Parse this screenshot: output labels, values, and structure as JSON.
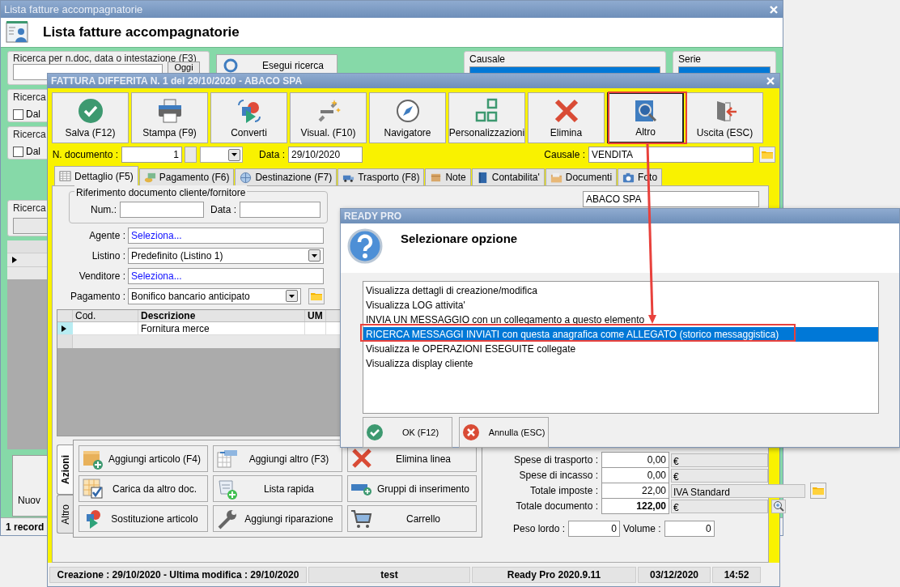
{
  "background_window": {
    "title": "Lista fatture accompagnatorie",
    "heading": "Lista fatture accompagnatorie",
    "search_group": {
      "label": "Ricerca per n.doc, data o intestazione (F3)",
      "button": "Oggi"
    },
    "search_button": "Esegui ricerca",
    "causale_label": "Causale",
    "serie_label": "Serie",
    "filters": [
      {
        "label": "Ricerca",
        "option": "Dal",
        "checked": false
      },
      {
        "label": "Ricerca",
        "option": "Dal",
        "checked": false
      }
    ],
    "search_label": "Ricerca",
    "new_button": "Nuov",
    "status": "1 record"
  },
  "invoice_window": {
    "title": "FATTURA DIFFERITA N. 1 del 29/10/2020 - ABACO SPA",
    "toolbar": [
      {
        "label": "Salva (F12)",
        "kind": "save",
        "selected": false
      },
      {
        "label": "Stampa (F9)",
        "kind": "print",
        "selected": false
      },
      {
        "label": "Converti",
        "kind": "convert",
        "selected": false
      },
      {
        "label": "Visual. (F10)",
        "kind": "visual",
        "selected": false
      },
      {
        "label": "Navigatore",
        "kind": "compass",
        "selected": false
      },
      {
        "label": "Personalizzazioni",
        "kind": "custom",
        "selected": false
      },
      {
        "label": "Elimina",
        "kind": "delete",
        "selected": false
      },
      {
        "label": "Altro",
        "kind": "other",
        "selected": true
      },
      {
        "label": "Uscita (ESC)",
        "kind": "exit",
        "selected": false
      }
    ],
    "doc_number": {
      "label": "N. documento :",
      "value": "1"
    },
    "date": {
      "label": "Data :",
      "value": "29/10/2020"
    },
    "causale": {
      "label": "Causale :",
      "value": "VENDITA"
    },
    "tabs": [
      {
        "label": "Dettaglio (F5)",
        "kind": "table",
        "selected": true
      },
      {
        "label": "Pagamento (F6)",
        "kind": "money",
        "selected": false
      },
      {
        "label": "Destinazione (F7)",
        "kind": "globe",
        "selected": false
      },
      {
        "label": "Trasporto (F8)",
        "kind": "truck",
        "selected": false
      },
      {
        "label": "Note",
        "kind": "note",
        "selected": false
      },
      {
        "label": "Contabilita'",
        "kind": "book",
        "selected": false
      },
      {
        "label": "Documenti",
        "kind": "folder",
        "selected": false
      },
      {
        "label": "Foto",
        "kind": "camera",
        "selected": false
      }
    ],
    "reference": {
      "label": "Riferimento documento cliente/fornitore",
      "num_label": "Num.:",
      "date_label": "Data :"
    },
    "customer": "ABACO SPA",
    "fields": [
      {
        "label": "Agente :",
        "value": "Seleziona...",
        "kind": "link"
      },
      {
        "label": "Listino :",
        "value": "Predefinito (Listino 1)",
        "kind": "select"
      },
      {
        "label": "Venditore :",
        "value": "Seleziona...",
        "kind": "link"
      },
      {
        "label": "Pagamento :",
        "value": "Bonifico bancario anticipato",
        "kind": "select_folder"
      }
    ],
    "grid": {
      "columns": [
        {
          "label": "Cod.",
          "bold": false
        },
        {
          "label": "Descrizione",
          "bold": true
        },
        {
          "label": "UM",
          "bold": true
        }
      ],
      "rows": [
        {
          "description": "Fornitura merce",
          "selected": true
        }
      ]
    },
    "side_tabs": [
      {
        "label": "Azioni",
        "selected": true
      },
      {
        "label": "Altro",
        "selected": false
      }
    ],
    "actions": [
      {
        "label": "Aggiungi articolo (F4)",
        "kind": "box_add"
      },
      {
        "label": "Aggiungi altro (F3)",
        "kind": "table_add"
      },
      {
        "label": "Elimina linea",
        "kind": "delete"
      },
      {
        "label": "Carica da altro doc.",
        "kind": "table_check"
      },
      {
        "label": "Lista rapida",
        "kind": "list_add"
      },
      {
        "label": "Gruppi di inserimento",
        "kind": "group_add"
      },
      {
        "label": "Sostituzione articolo",
        "kind": "convert"
      },
      {
        "label": "Aggiungi riparazione",
        "kind": "wrench"
      },
      {
        "label": "Carrello",
        "kind": "cart"
      }
    ],
    "totals": [
      {
        "label": "Spese di trasporto :",
        "value": "0,00",
        "unit": "€",
        "bold": false,
        "kind": "plain"
      },
      {
        "label": "Spese di incasso :",
        "value": "0,00",
        "unit": "€",
        "bold": false,
        "kind": "plain"
      },
      {
        "label": "Totale imposte :",
        "value": "22,00",
        "unit": "IVA Standard",
        "bold": false,
        "kind": "folder"
      },
      {
        "label": "Totale documento :",
        "value": "122,00",
        "unit": "€",
        "bold": true,
        "kind": "zoom"
      }
    ],
    "peso": {
      "label": "Peso lordo :",
      "value": "0"
    },
    "volume": {
      "label": "Volume :",
      "value": "0"
    },
    "status": [
      "Creazione : 29/10/2020 - Ultima modifica : 29/10/2020",
      "test",
      "Ready Pro 2020.9.11",
      "03/12/2020",
      "14:52"
    ]
  },
  "dialog": {
    "title": "READY PRO",
    "heading": "Selezionare opzione",
    "options": [
      {
        "label": "Visualizza dettagli di creazione/modifica",
        "selected": false
      },
      {
        "label": "Visualizza LOG attivita'",
        "selected": false
      },
      {
        "label": "INVIA UN MESSAGGIO con un collegamento a questo elemento",
        "selected": false
      },
      {
        "label": "RICERCA MESSAGGI INVIATI con questa anagrafica come ALLEGATO (storico messaggistica)",
        "selected": true
      },
      {
        "label": "Visualizza le OPERAZIONI ESEGUITE collegate",
        "selected": false
      },
      {
        "label": "Visualizza display cliente",
        "selected": false
      }
    ],
    "buttons": [
      {
        "label": "OK (F12)",
        "kind": "ok"
      },
      {
        "label": "Annulla (ESC)",
        "kind": "cancel"
      }
    ]
  }
}
